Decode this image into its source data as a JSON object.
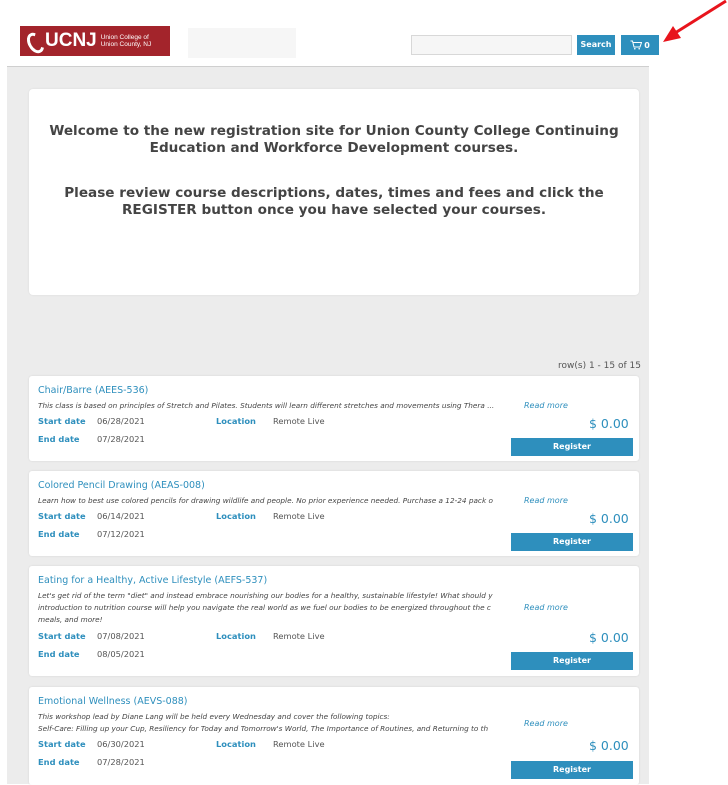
{
  "header": {
    "logo_word": "UCNJ",
    "logo_sub_line1": "Union College of",
    "logo_sub_line2": "Union County, NJ",
    "search_value": "",
    "search_placeholder": "",
    "search_button": "Search",
    "cart_count": "0",
    "accent_color": "#2e8fbd",
    "brand_color": "#a3242b",
    "annotation_arrow_color": "#e8141c"
  },
  "welcome": {
    "line1": "Welcome to the new registration site for Union County College Continuing Education and Workforce Development courses.",
    "line2": "Please review course descriptions, dates, times and fees and click the REGISTER button once you have selected your courses."
  },
  "results": {
    "row_count": "row(s) 1 - 15 of 15"
  },
  "labels": {
    "start_date": "Start date",
    "end_date": "End date",
    "location": "Location",
    "read_more": "Read more",
    "register": "Register"
  },
  "courses": [
    {
      "title": "Chair/Barre (AEES-536)",
      "description": [
        "This class is based on principles of Stretch and Pilates. Students will learn different stretches and movements using Thera ..."
      ],
      "start_date": "06/28/2021",
      "end_date": "07/28/2021",
      "location": "Remote Live",
      "price": "$ 0.00"
    },
    {
      "title": "Colored Pencil Drawing (AEAS-008)",
      "description": [
        "Learn how to best use colored pencils for drawing wildlife and people. No prior experience needed.  Purchase a 12-24 pack o"
      ],
      "start_date": "06/14/2021",
      "end_date": "07/12/2021",
      "location": "Remote Live",
      "price": "$ 0.00"
    },
    {
      "title": "Eating for a Healthy, Active Lifestyle (AEFS-537)",
      "description": [
        "Let's get rid of the term \"diet\" and instead embrace nourishing our bodies for a healthy, sustainable lifestyle! What should y",
        "introduction to nutrition course will help you navigate the real world as we fuel our bodies to be energized throughout the c",
        "meals, and more!"
      ],
      "start_date": "07/08/2021",
      "end_date": "08/05/2021",
      "location": "Remote Live",
      "price": "$ 0.00"
    },
    {
      "title": "Emotional Wellness (AEVS-088)",
      "description": [
        "This workshop lead by Diane Lang will be held every Wednesday and cover the following topics:",
        "Self-Care: Filling up your Cup, Resiliency for Today and Tomorrow's World, The Importance of Routines, and Returning to th"
      ],
      "start_date": "06/30/2021",
      "end_date": "07/28/2021",
      "location": "Remote Live",
      "price": "$ 0.00"
    }
  ]
}
